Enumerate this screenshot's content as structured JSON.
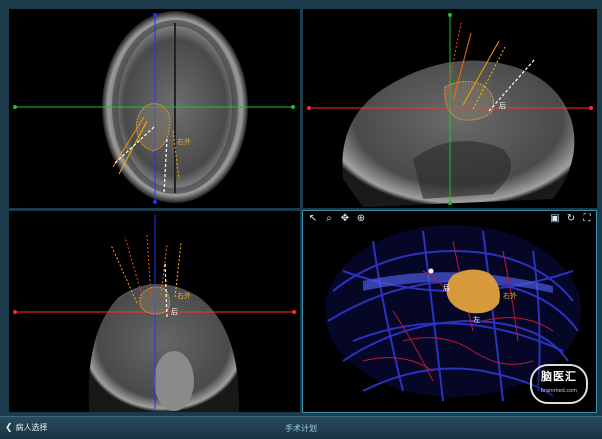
{
  "views": {
    "axial": {
      "labels": {
        "right": "右外"
      }
    },
    "sagittal": {
      "labels": {
        "back": "后"
      }
    },
    "coronal": {
      "labels": {
        "back": "后",
        "right": "右外"
      }
    },
    "volume3d": {
      "labels": {
        "back": "后",
        "outer": "右外",
        "left": "左"
      },
      "toolbar": {
        "left": [
          "pointer-icon",
          "zoom-icon",
          "pan-icon",
          "rotate-icon"
        ],
        "right": [
          "layers-icon",
          "refresh-icon",
          "fullscreen-icon"
        ]
      }
    }
  },
  "watermark": {
    "main": "脑医汇",
    "sub": "brainmed.com"
  },
  "statusbar": {
    "back_label": "病人选择",
    "title": "手术计划"
  },
  "colors": {
    "tumor": "#d79a3a",
    "vessels_blue": "#2c35c8",
    "vessels_red": "#c0173a",
    "crosshair_red": "#ff2b2b",
    "crosshair_green": "#1fbf2a",
    "crosshair_blue": "#2233ff"
  }
}
